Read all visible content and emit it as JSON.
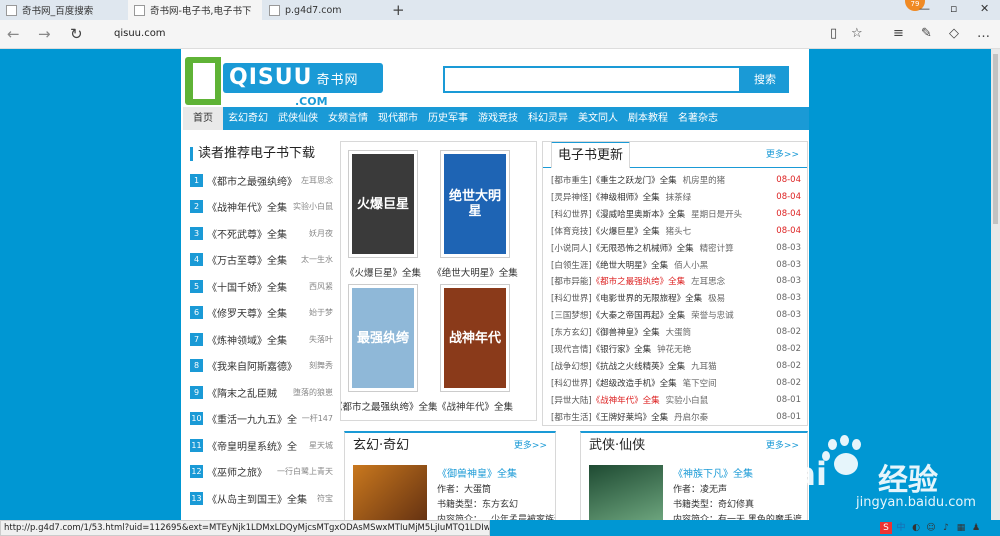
{
  "tabs": [
    {
      "title": "奇书网_百度搜索",
      "active": false
    },
    {
      "title": "奇书网-电子书,电子书下",
      "active": true
    },
    {
      "title": "p.g4d7.com",
      "active": false
    }
  ],
  "avatar_badge": "79",
  "address": "qisuu.com",
  "logo": {
    "brand": "QISUU",
    "cn": "奇书网",
    "domain": ".COM"
  },
  "search_button": "搜索",
  "nav": [
    "首页",
    "玄幻奇幻",
    "武侠仙侠",
    "女频言情",
    "现代都市",
    "历史军事",
    "游戏竞技",
    "科幻灵异",
    "美文同人",
    "剧本教程",
    "名著杂志"
  ],
  "recommend": {
    "title": "读者推荐电子书下载",
    "items": [
      {
        "n": "1",
        "title": "《都市之最强纨绔》",
        "author": "左耳思念"
      },
      {
        "n": "2",
        "title": "《战神年代》全集",
        "author": "实验小白鼠"
      },
      {
        "n": "3",
        "title": "《不死武尊》全集",
        "author": "妖月夜"
      },
      {
        "n": "4",
        "title": "《万古至尊》全集",
        "author": "太一生水"
      },
      {
        "n": "5",
        "title": "《十国千娇》全集",
        "author": "西风紧"
      },
      {
        "n": "6",
        "title": "《修罗天尊》全集",
        "author": "始于梦"
      },
      {
        "n": "7",
        "title": "《炼神领域》全集",
        "author": "失落叶"
      },
      {
        "n": "8",
        "title": "《我来自阿斯嘉德》",
        "author": "刻舞秀"
      },
      {
        "n": "9",
        "title": "《隋末之乱臣贼",
        "author": "堕落的狼崽"
      },
      {
        "n": "10",
        "title": "《重活一九九五》全",
        "author": "一杆147"
      },
      {
        "n": "11",
        "title": "《帝皇明星系统》全",
        "author": "星天城"
      },
      {
        "n": "12",
        "title": "《巫师之旅》",
        "author": "一行白鹭上青天"
      },
      {
        "n": "13",
        "title": "《从岛主到国王》全集",
        "author": "符宝"
      }
    ]
  },
  "covers": [
    {
      "caption": "《火爆巨星》全集",
      "art": "火爆巨星",
      "color": "#3a3a3a"
    },
    {
      "caption": "《绝世大明星》全集",
      "art": "绝世大明星",
      "color": "#1e64b4"
    },
    {
      "caption": "《都市之最强纨绔》全集",
      "art": "最强纨绔",
      "color": "#8fb8d8"
    },
    {
      "caption": "《战神年代》全集",
      "art": "战神年代",
      "color": "#8a3a1a"
    }
  ],
  "updates": {
    "title": "电子书更新",
    "more": "更多>>",
    "rows": [
      {
        "cat": "[都市重生]",
        "book": "《重生之跃龙门》全集",
        "author": "机房里的猪",
        "date": "08-04",
        "red_book": false,
        "red_date": true
      },
      {
        "cat": "[灵异神怪]",
        "book": "《神级相师》全集",
        "author": "抹茶绿",
        "date": "08-04",
        "red_book": false,
        "red_date": true
      },
      {
        "cat": "[科幻世界]",
        "book": "《漫威哈里奥斯本》全集",
        "author": "星期日是开头",
        "date": "08-04",
        "red_book": false,
        "red_date": true
      },
      {
        "cat": "[体育竞技]",
        "book": "《火爆巨星》全集",
        "author": "猪头七",
        "date": "08-04",
        "red_book": false,
        "red_date": true
      },
      {
        "cat": "[小说同人]",
        "book": "《无限恐怖之机械师》全集",
        "author": "精密计算",
        "date": "08-03",
        "red_book": false,
        "red_date": false
      },
      {
        "cat": "[白领生涯]",
        "book": "《绝世大明星》全集",
        "author": "佰人小黑",
        "date": "08-03",
        "red_book": false,
        "red_date": false
      },
      {
        "cat": "[都市异能]",
        "book": "《都市之最强纨绔》全集",
        "author": "左耳思念",
        "date": "08-03",
        "red_book": true,
        "red_date": false
      },
      {
        "cat": "[科幻世界]",
        "book": "《电影世界的无限旅程》全集",
        "author": "极易",
        "date": "08-03",
        "red_book": false,
        "red_date": false
      },
      {
        "cat": "[三国梦想]",
        "book": "《大秦之帝国再起》全集",
        "author": "荣誉与忠诚",
        "date": "08-03",
        "red_book": false,
        "red_date": false
      },
      {
        "cat": "[东方玄幻]",
        "book": "《御兽神皇》全集",
        "author": "大蛋筒",
        "date": "08-02",
        "red_book": false,
        "red_date": false
      },
      {
        "cat": "[现代言情]",
        "book": "《银行家》全集",
        "author": "钟花无艳",
        "date": "08-02",
        "red_book": false,
        "red_date": false
      },
      {
        "cat": "[战争幻想]",
        "book": "《抗战之火线精英》全集",
        "author": "九耳猫",
        "date": "08-02",
        "red_book": false,
        "red_date": false
      },
      {
        "cat": "[科幻世界]",
        "book": "《超级改造手机》全集",
        "author": "笔下空间",
        "date": "08-02",
        "red_book": false,
        "red_date": false
      },
      {
        "cat": "[异世大陆]",
        "book": "《战神年代》全集",
        "author": "实验小白鼠",
        "date": "08-01",
        "red_book": true,
        "red_date": false
      },
      {
        "cat": "[都市生活]",
        "book": "《王牌好莱坞》全集",
        "author": "丹启尔秦",
        "date": "08-01",
        "red_book": false,
        "red_date": false
      }
    ]
  },
  "xuanhuan": {
    "title": "玄幻·奇幻",
    "more": "更多>>",
    "book": "《御兽神皇》全集",
    "author": "作者：大蛋筒",
    "type": "书籍类型：东方玄幻",
    "intro": "内容简介：…少年孟晨被家族逐出家"
  },
  "wuxia": {
    "title": "武侠·仙侠",
    "more": "更多>>",
    "book": "《神族下凡》全集",
    "author": "作者：凌无声",
    "type": "书籍类型：奇幻修真",
    "intro": "内容简介：有一天,黑色的魔手遮"
  },
  "status_url": "http://p.g4d7.com/1/53.html?uid=112695&ext=MTEyNjk1LDMxLDQyMjcsMTgxODAsMSwxMTIuMjM5LjIuMTQ1LDIwMTYwODA1MTEzNDEw",
  "watermark": {
    "brand": "Bai",
    "brand2": "经验",
    "sub": "jingyan.baidu.com"
  },
  "colors": {
    "accent": "#1a9ad6",
    "background": "#0097d3",
    "red": "#dd2222"
  }
}
